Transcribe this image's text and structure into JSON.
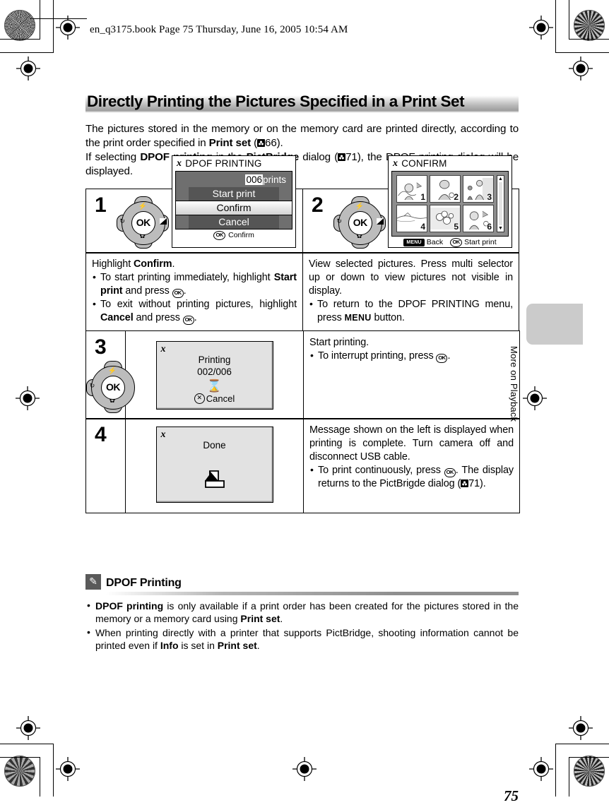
{
  "header": {
    "text": "en_q3175.book  Page 75  Thursday, June 16, 2005  10:54 AM"
  },
  "title": "Directly Printing the Pictures Specified in a Print Set",
  "intro": {
    "line1_a": "The pictures stored in the memory or on the memory card are printed directly, according to the print order specified in ",
    "line1_b": "Print set",
    "line1_c": " (",
    "ref1": "66",
    "line1_d": ").",
    "line2_a": "If selecting ",
    "line2_b": "DPOF printing",
    "line2_c": " in the ",
    "line2_d": "PictBridge",
    "line2_e": " dialog (",
    "ref2": "71",
    "line2_f": "), the DPOF printing dialog will be displayed."
  },
  "steps": [
    {
      "number": "1",
      "screen": {
        "title": "DPOF PRINTING",
        "prints_count": "006",
        "prints_label": "prints",
        "items": [
          "Start print",
          "Confirm",
          "Cancel"
        ],
        "selected": "Confirm",
        "footer_button": "OK",
        "footer_label": "Confirm"
      },
      "desc": {
        "lead_a": "Highlight ",
        "lead_b": "Confirm",
        "lead_c": ".",
        "bullets": [
          {
            "a": "To start printing immediately, highlight ",
            "b": "Start print",
            "c": " and press ",
            "key": "OK",
            "d": "."
          },
          {
            "a": "To exit without printing pictures, highlight ",
            "b": "Cancel",
            "c": " and press ",
            "key": "OK",
            "d": "."
          }
        ]
      }
    },
    {
      "number": "2",
      "screen": {
        "title": "CONFIRM",
        "thumbnails": [
          "1",
          "2",
          "3",
          "4",
          "5",
          "6"
        ],
        "footer_menu_pill": "MENU",
        "footer_menu_label": "Back",
        "footer_ok_pill": "OK",
        "footer_ok_label": "Start print"
      },
      "desc": {
        "lead": "View selected pictures. Press multi selector up or down to view pictures not visible in display.",
        "bullets": [
          {
            "a": "To return to the DPOF PRINTING menu, press ",
            "b": "MENU",
            "c": " button."
          }
        ]
      }
    },
    {
      "number": "3",
      "screen": {
        "message": "Printing",
        "progress": "002/006",
        "icon": "hourglass-icon",
        "cancel_label": "Cancel"
      },
      "desc": {
        "lead": "Start printing.",
        "bullets": [
          {
            "a": "To interrupt printing, press ",
            "key": "OK",
            "b": "."
          }
        ]
      }
    },
    {
      "number": "4",
      "screen": {
        "message": "Done",
        "icon": "printer-icon"
      },
      "desc": {
        "lead": "Message shown on the left is displayed when printing is complete. Turn camera off and disconnect USB cable.",
        "bullets": [
          {
            "a": "To print continuously, press ",
            "key": "OK",
            "b": ". The display returns to the PictBrigde dialog (",
            "ref": "71",
            "c": ")."
          }
        ]
      }
    }
  ],
  "note": {
    "icon": "pencil-icon",
    "title": "DPOF Printing",
    "bullets": [
      {
        "a": "",
        "bold1": "DPOF printing",
        "b": " is only available if a print order has been created for the pictures stored in the memory or a memory card using ",
        "bold2": "Print set",
        "c": "."
      },
      {
        "a": "When printing directly with a printer that supports PictBridge, shooting information cannot be printed even if ",
        "bold1": "Info",
        "b": " is set in ",
        "bold2": "Print set",
        "c": "."
      }
    ]
  },
  "page_number": "75",
  "side_tab_label": "More on Playback",
  "multi_selector": {
    "center_label": "OK",
    "up_icon": "flash-icon",
    "down_icon": "macro-icon",
    "left_icon": "self-timer-icon",
    "right_icon": "exposure-compensation-icon"
  }
}
